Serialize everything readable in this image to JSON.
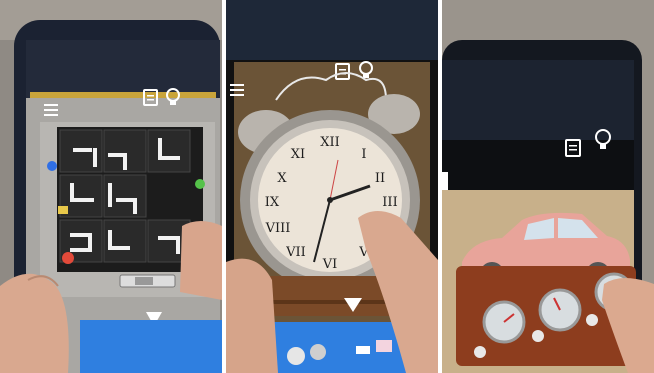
{
  "panels": [
    {
      "scene": "phone-tile-puzzle",
      "icons": [
        "menu-icon",
        "notes-icon",
        "lightbulb-icon",
        "play-triangle-icon"
      ],
      "colors": {
        "pavement": "#8f8a84",
        "screen_bg": "#a9a7a3",
        "board": "#1c1c1c",
        "bar": "#2f7fe0",
        "led_blue": "#2f6fe6",
        "led_yellow": "#e8c84a",
        "led_red": "#e24a3a",
        "led_green": "#55c24a"
      }
    },
    {
      "scene": "phone-alarm-clock",
      "icons": [
        "menu-icon",
        "notes-icon",
        "lightbulb-icon",
        "play-triangle-icon"
      ],
      "colors": {
        "wall": "#6b5437",
        "clock_face": "#ece4d8",
        "bell": "#b9b4ad",
        "wood": "#7b4a28",
        "bar": "#2f7fe0"
      }
    },
    {
      "scene": "phone-toy-car-gauges",
      "icons": [
        "notes-icon",
        "lightbulb-icon"
      ],
      "colors": {
        "sky": "#1c2330",
        "car": "#e8a49a",
        "wood": "#8d3d1e",
        "gauge": "#d8dde0",
        "panel_bg": "#c8b08a"
      }
    }
  ]
}
